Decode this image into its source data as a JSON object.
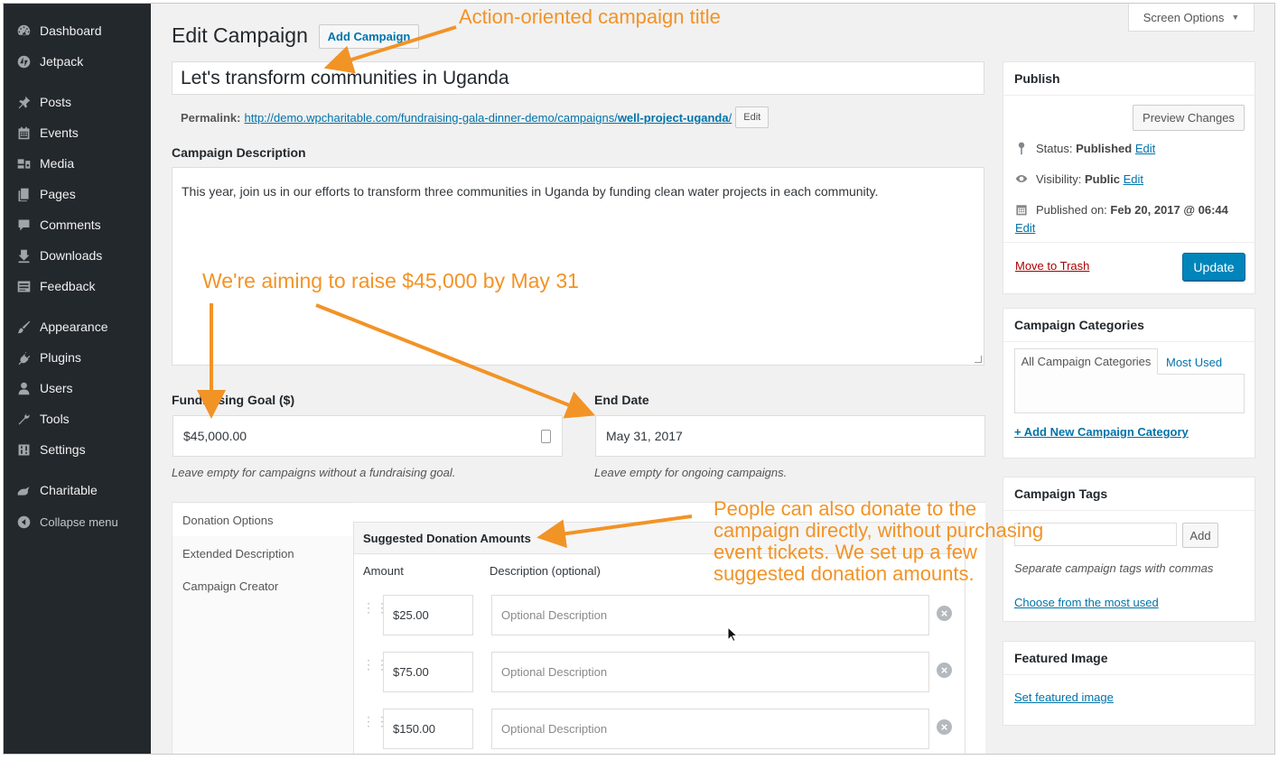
{
  "sidebar": {
    "items": [
      {
        "label": "Dashboard",
        "icon": "dashboard-icon"
      },
      {
        "label": "Jetpack",
        "icon": "jetpack-icon"
      },
      {
        "label": "Posts",
        "icon": "pin-icon"
      },
      {
        "label": "Events",
        "icon": "calendar-icon"
      },
      {
        "label": "Media",
        "icon": "media-icon"
      },
      {
        "label": "Pages",
        "icon": "pages-icon"
      },
      {
        "label": "Comments",
        "icon": "comment-icon"
      },
      {
        "label": "Downloads",
        "icon": "download-icon"
      },
      {
        "label": "Feedback",
        "icon": "feedback-icon"
      },
      {
        "label": "Appearance",
        "icon": "brush-icon"
      },
      {
        "label": "Plugins",
        "icon": "plug-icon"
      },
      {
        "label": "Users",
        "icon": "user-icon"
      },
      {
        "label": "Tools",
        "icon": "wrench-icon"
      },
      {
        "label": "Settings",
        "icon": "settings-icon"
      },
      {
        "label": "Charitable",
        "icon": "charitable-icon"
      }
    ],
    "collapse_label": "Collapse menu"
  },
  "header": {
    "title": "Edit Campaign",
    "add_button": "Add Campaign",
    "screen_options": "Screen Options"
  },
  "campaign": {
    "title": "Let's transform communities in Uganda",
    "permalink_label": "Permalink:",
    "permalink_base": "http://demo.wpcharitable.com/fundraising-gala-dinner-demo/campaigns/",
    "permalink_slug": "well-project-uganda",
    "permalink_end": "/",
    "permalink_edit": "Edit",
    "description_label": "Campaign Description",
    "description": "This year, join us in our efforts to transform three communities in Uganda by funding clean water projects in each community.",
    "goal_label": "Fundraising Goal ($)",
    "goal_value": "$45,000.00",
    "goal_hint": "Leave empty for campaigns without a fundraising goal.",
    "end_label": "End Date",
    "end_value": "May 31, 2017",
    "end_hint": "Leave empty for ongoing campaigns."
  },
  "tabs": [
    "Donation Options",
    "Extended Description",
    "Campaign Creator"
  ],
  "donations": {
    "heading": "Suggested Donation Amounts",
    "col_amount": "Amount",
    "col_description": "Description (optional)",
    "placeholder": "Optional Description",
    "rows": [
      {
        "amount": "$25.00"
      },
      {
        "amount": "$75.00"
      },
      {
        "amount": "$150.00"
      }
    ]
  },
  "publish": {
    "title": "Publish",
    "preview": "Preview Changes",
    "status_label": "Status:",
    "status_value": "Published",
    "visibility_label": "Visibility:",
    "visibility_value": "Public",
    "published_label": "Published on:",
    "published_value": "Feb 20, 2017 @ 06:44",
    "edit": "Edit",
    "trash": "Move to Trash",
    "update": "Update"
  },
  "categories": {
    "title": "Campaign Categories",
    "tab_all": "All Campaign Categories",
    "tab_used": "Most Used",
    "add_new": "+ Add New Campaign Category"
  },
  "tags": {
    "title": "Campaign Tags",
    "add": "Add",
    "hint": "Separate campaign tags with commas",
    "choose": "Choose from the most used"
  },
  "featured": {
    "title": "Featured Image",
    "set": "Set featured image"
  },
  "annotations": {
    "title_note": "Action-oriented campaign title",
    "goal_note": "We're aiming to raise $45,000 by May 31",
    "donate_note_1": "People can also donate to the",
    "donate_note_2": "campaign directly, without purchasing",
    "donate_note_3": "event tickets. We set up a few",
    "donate_note_4": "suggested donation amounts."
  },
  "colors": {
    "sidebar_bg": "#23282d",
    "link": "#0073aa",
    "primary": "#0085ba",
    "annotation": "#f29326",
    "trash": "#a00"
  }
}
